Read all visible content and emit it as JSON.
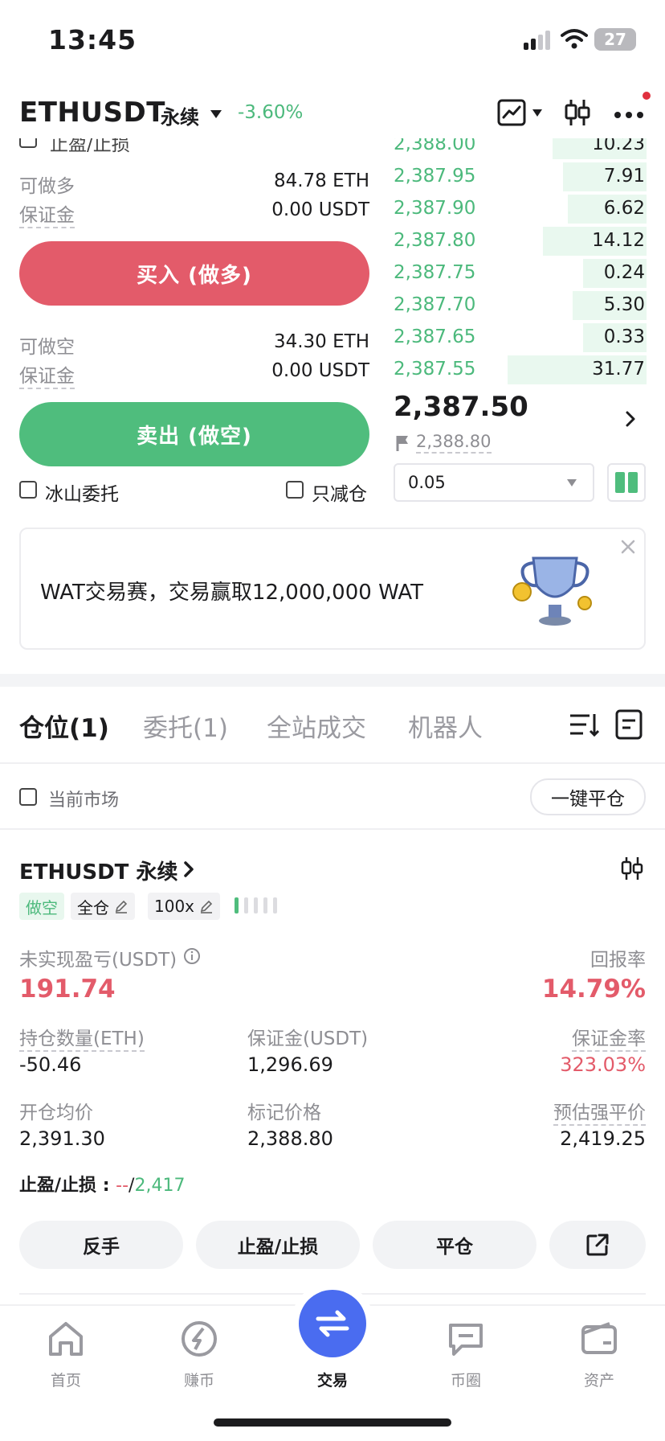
{
  "status_bar": {
    "time": "13:45",
    "battery": "27"
  },
  "header": {
    "pair": "ETHUSDT",
    "contract_type": "永续",
    "change": "-3.60%"
  },
  "order_form": {
    "partial_checkbox_label": "止盈/止损",
    "long": {
      "label": "可做多",
      "value": "84.78 ETH",
      "margin_label": "保证金",
      "margin_value": "0.00 USDT",
      "button": "买入 (做多)"
    },
    "short": {
      "label": "可做空",
      "value": "34.30 ETH",
      "margin_label": "保证金",
      "margin_value": "0.00 USDT",
      "button": "卖出 (做空)"
    },
    "iceberg_label": "冰山委托",
    "reduce_only_label": "只减仓"
  },
  "orderbook": {
    "rows": [
      {
        "price": "2,388.00",
        "qty": "10.23",
        "depth": 0.18
      },
      {
        "price": "2,387.95",
        "qty": "7.91",
        "depth": 0.14
      },
      {
        "price": "2,387.90",
        "qty": "6.62",
        "depth": 0.12
      },
      {
        "price": "2,387.80",
        "qty": "14.12",
        "depth": 0.22
      },
      {
        "price": "2,387.75",
        "qty": "0.24",
        "depth": 0.06
      },
      {
        "price": "2,387.70",
        "qty": "5.30",
        "depth": 0.1
      },
      {
        "price": "2,387.65",
        "qty": "0.33",
        "depth": 0.06
      },
      {
        "price": "2,387.55",
        "qty": "31.77",
        "depth": 0.36
      }
    ],
    "last_price": "2,387.50",
    "mark_price": "2,388.80",
    "precision_value": "0.05"
  },
  "banner": {
    "text": "WAT交易赛，交易赢取12,000,000 WAT"
  },
  "tabs": [
    {
      "label": "仓位(1)",
      "active": true
    },
    {
      "label": "委托(1)",
      "active": false
    },
    {
      "label": "全站成交",
      "active": false
    },
    {
      "label": "机器人",
      "active": false
    }
  ],
  "filter": {
    "current_market_label": "当前市场",
    "close_all_button": "一键平仓"
  },
  "position": {
    "symbol": "ETHUSDT 永续",
    "side_tag": "做空",
    "margin_mode_tag": "全仓",
    "leverage_tag": "100x",
    "unrealized_pnl_label": "未实现盈亏(USDT)",
    "unrealized_pnl_value": "191.74",
    "roe_label": "回报率",
    "roe_value": "14.79%",
    "size_label": "持仓数量(ETH)",
    "size_value": "-50.46",
    "margin_label": "保证金(USDT)",
    "margin_value": "1,296.69",
    "margin_ratio_label": "保证金率",
    "margin_ratio_value": "323.03%",
    "entry_label": "开仓均价",
    "entry_value": "2,391.30",
    "mark_label": "标记价格",
    "mark_value": "2,388.80",
    "liq_label": "预估强平价",
    "liq_value": "2,419.25",
    "tpsl_label": "止盈/止损 : ",
    "tp_value": "--",
    "slash": "/",
    "sl_value": "2,417",
    "actions": [
      "反手",
      "止盈/止损",
      "平仓"
    ]
  },
  "bottom_nav": [
    {
      "label": "首页",
      "active": false
    },
    {
      "label": "赚币",
      "active": false
    },
    {
      "label": "交易",
      "active": true
    },
    {
      "label": "币圈",
      "active": false
    },
    {
      "label": "资产",
      "active": false
    }
  ],
  "colors": {
    "green": "#4cb97c",
    "red": "#e35b6a",
    "accent": "#4a6cf0"
  }
}
